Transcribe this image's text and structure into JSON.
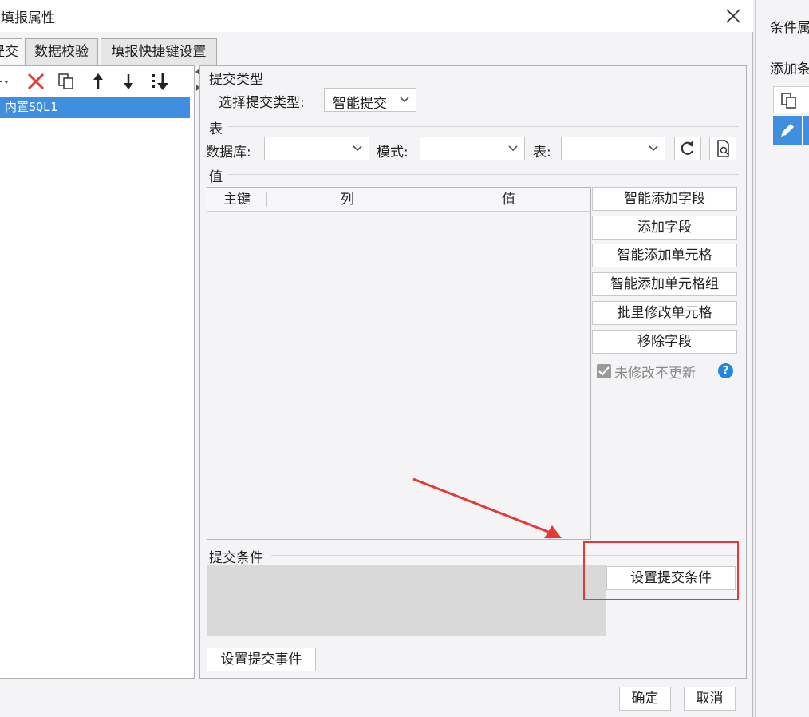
{
  "dialog": {
    "title": "表填报属性",
    "close_glyph": "✕"
  },
  "tabs": [
    {
      "label": "提交"
    },
    {
      "label": "数据校验"
    },
    {
      "label": "填报快捷键设置"
    }
  ],
  "left_panel": {
    "items": [
      {
        "label": "内置SQL1"
      }
    ]
  },
  "submit_type": {
    "section_title": "提交类型",
    "select_label": "选择提交类型:",
    "selected_value": "智能提交"
  },
  "table_section": {
    "section_title": "表",
    "database_label": "数据库:",
    "database_value": "",
    "schema_label": "模式:",
    "schema_value": "",
    "table_label": "表:",
    "table_value": ""
  },
  "value_section": {
    "section_title": "值",
    "columns": [
      "主键",
      "列",
      "值"
    ],
    "rows": []
  },
  "side_buttons": {
    "smart_add_field": "智能添加字段",
    "add_field": "添加字段",
    "smart_add_cell": "智能添加单元格",
    "smart_add_cell_group": "智能添加单元格组",
    "batch_modify_cell": "批里修改单元格",
    "remove_field": "移除字段",
    "no_update_checkbox_label": "未修改不更新",
    "no_update_checked": true,
    "help_glyph": "?"
  },
  "condition_section": {
    "section_title": "提交条件",
    "set_condition_button": "设置提交条件"
  },
  "event": {
    "set_event_button": "设置提交事件"
  },
  "footer": {
    "ok_button": "确定",
    "cancel_button": "取消"
  },
  "side_window": {
    "title": "条件属",
    "add_label": "添加条"
  },
  "colors": {
    "selection_blue": "#3f8ee0",
    "annotation_red": "#e53935",
    "help_blue": "#1e88e5",
    "delete_red": "#e53935"
  }
}
